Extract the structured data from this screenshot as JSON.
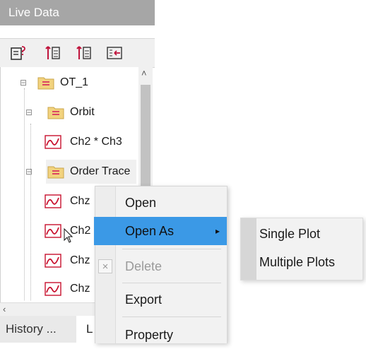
{
  "panel": {
    "title": "Live Data",
    "toolbar_icons": [
      "properties-icon",
      "expand-tree-icon",
      "collapse-tree-icon",
      "collapse-all-icon"
    ]
  },
  "tree": {
    "nodes": [
      {
        "label": "OT_1",
        "icon": "folder-icon",
        "expander": "⊟"
      },
      {
        "label": "Orbit",
        "icon": "folder-icon",
        "expander": "⊟"
      },
      {
        "label": "Ch2 * Ch3",
        "icon": "signal-icon"
      },
      {
        "label": "Order Trace",
        "icon": "folder-icon",
        "expander": "⊟"
      },
      {
        "label": "Chz",
        "icon": "signal-icon"
      },
      {
        "label": "Ch2",
        "icon": "signal-icon"
      },
      {
        "label": "Chz",
        "icon": "signal-icon"
      },
      {
        "label": "Chz",
        "icon": "signal-icon"
      }
    ]
  },
  "tabs": {
    "history": "History ...",
    "live": "L"
  },
  "context_menu": {
    "items": [
      {
        "label": "Open",
        "state": "normal"
      },
      {
        "label": "Open As",
        "state": "selected",
        "submenu_arrow": "▸"
      },
      {
        "label": "Delete",
        "state": "disabled",
        "icon": "×"
      },
      {
        "label": "Export",
        "state": "normal"
      },
      {
        "label": "Property",
        "state": "normal"
      }
    ]
  },
  "submenu": {
    "items": [
      "Single Plot",
      "Multiple Plots"
    ]
  },
  "colors": {
    "title_bar": "#a6a6a6",
    "selected": "#3b99e6",
    "folder": "#f2d27e",
    "folder_line": "#d6245d",
    "signal": "#c8102e"
  }
}
